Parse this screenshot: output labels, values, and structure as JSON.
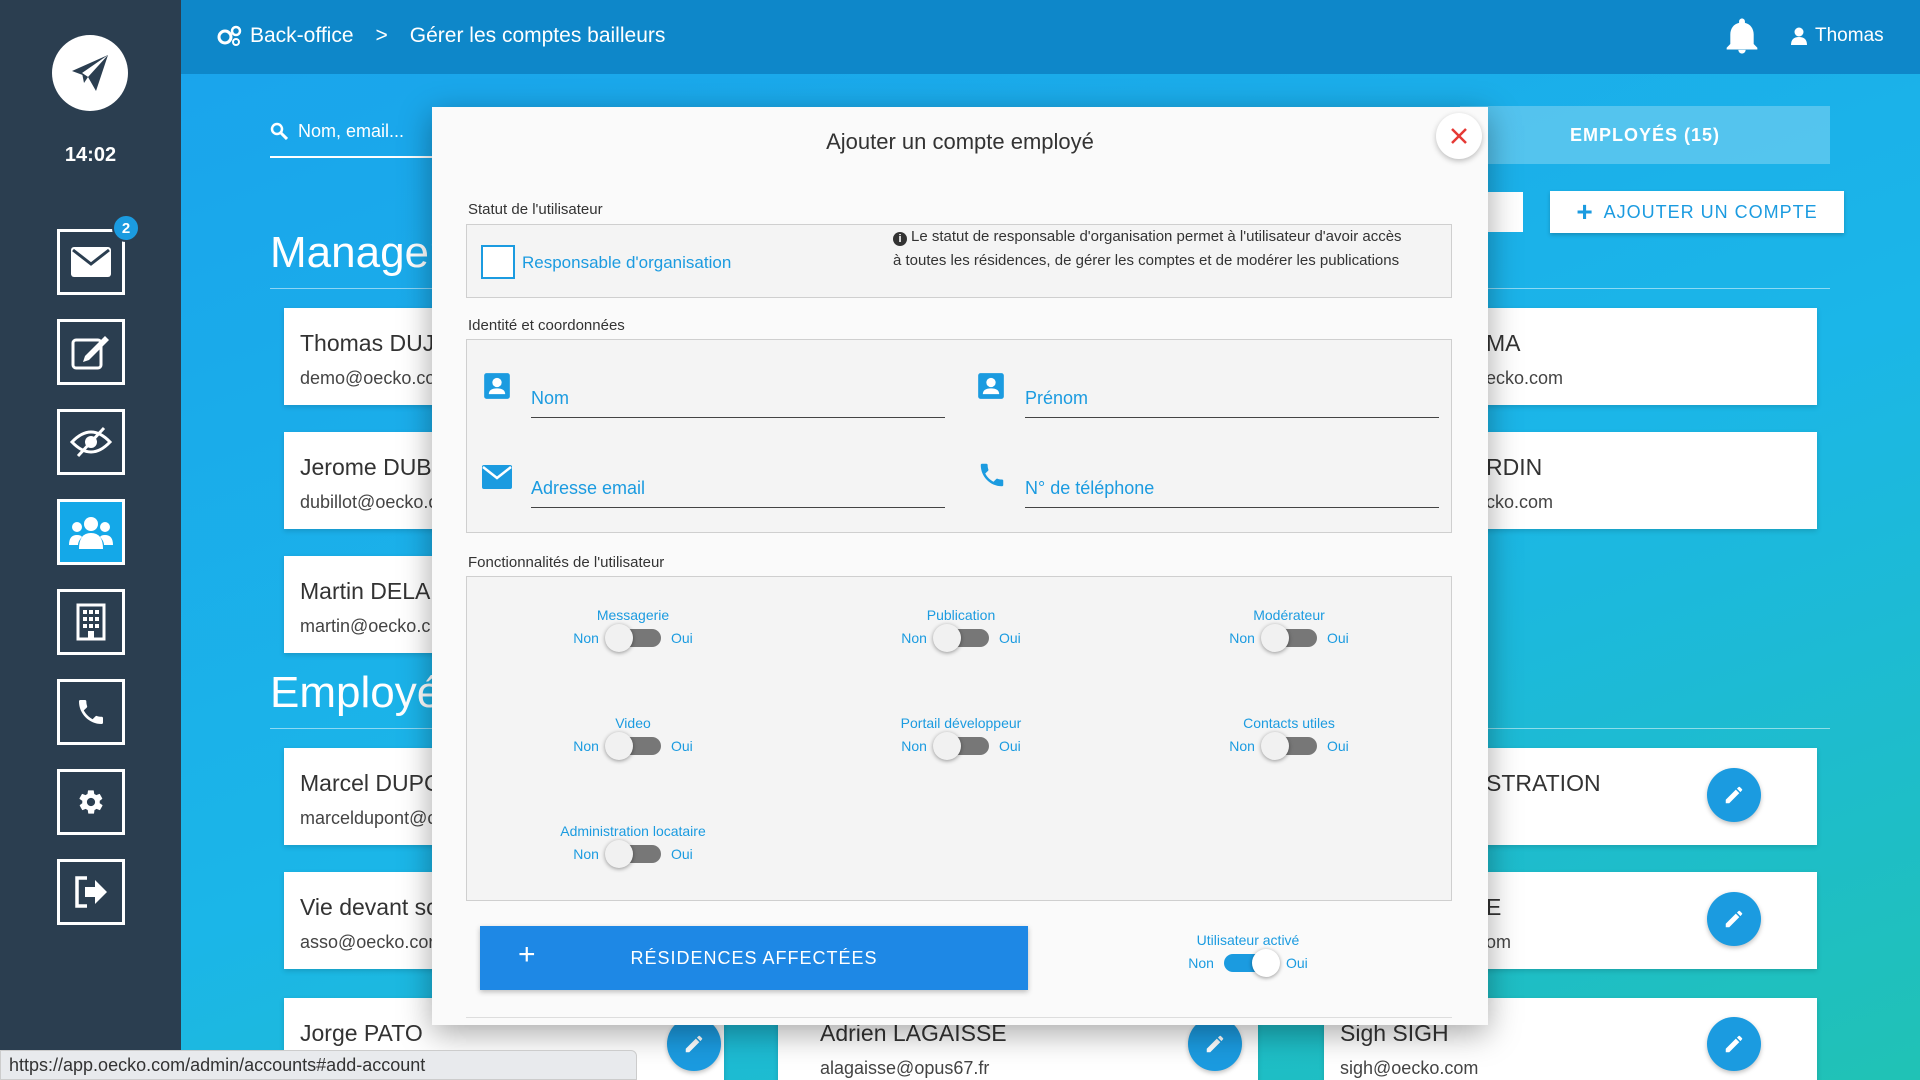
{
  "sidebar": {
    "time": "14:02",
    "mail_badge": "2"
  },
  "topbar": {
    "crumb_root": "Back-office",
    "crumb_sep": ">",
    "crumb_current": "Gérer les comptes bailleurs",
    "user_name": "Thomas"
  },
  "background": {
    "search_placeholder": "Nom, email...",
    "tab_employees": "EMPLOYÉS (15)",
    "add_account": "AJOUTER UN COMPTE",
    "section_managers": "Managers",
    "section_employees": "Employés",
    "managers": [
      {
        "name": "Thomas DUJ",
        "email": "demo@oecko.co"
      },
      {
        "name": "Jerome DUB",
        "email": "dubillot@oecko.c"
      },
      {
        "name": "Martin DELA",
        "email": "martin@oecko.c"
      }
    ],
    "managers_right": [
      {
        "name": "MA",
        "email": "ecko.com"
      },
      {
        "name": "RDIN",
        "email": "cko.com"
      }
    ],
    "employees": [
      {
        "name": "Marcel DUPC",
        "email": "marceldupont@c"
      },
      {
        "name": "Vie devant sc",
        "email": "asso@oecko.cor"
      },
      {
        "name": "Jorge PATO",
        "email": ""
      }
    ],
    "employees_right": [
      {
        "name": "STRATION",
        "email": ""
      },
      {
        "name": "E",
        "email": "om"
      },
      {
        "name": "Sigh SIGH",
        "email": "sigh@oecko.com"
      }
    ],
    "employee_mid": {
      "name": "Adrien LAGAISSE",
      "email": "alagaisse@opus67.fr"
    },
    "status_url": "https://app.oecko.com/admin/accounts#add-account"
  },
  "modal": {
    "title": "Ajouter un compte employé",
    "status_section": "Statut de l'utilisateur",
    "org_manager_label": "Responsable d'organisation",
    "org_manager_checked": false,
    "org_manager_info": "Le statut de responsable d'organisation permet à l'utilisateur d'avoir accès à toutes les résidences, de gérer les comptes et de modérer les publications",
    "identity_section": "Identité et coordonnées",
    "fields": {
      "last_name": "Nom",
      "first_name": "Prénom",
      "email": "Adresse email",
      "phone": "N° de téléphone"
    },
    "features_section": "Fonctionnalités de l'utilisateur",
    "toggle_off": "Non",
    "toggle_on": "Oui",
    "features": [
      {
        "label": "Messagerie",
        "enabled": false
      },
      {
        "label": "Publication",
        "enabled": false
      },
      {
        "label": "Modérateur",
        "enabled": false
      },
      {
        "label": "Video",
        "enabled": false
      },
      {
        "label": "Portail développeur",
        "enabled": false
      },
      {
        "label": "Contacts utiles",
        "enabled": false
      },
      {
        "label": "Administration locataire",
        "enabled": false
      }
    ],
    "residences_button": "RÉSIDENCES AFFECTÉES",
    "active_user_label": "Utilisateur activé",
    "active_user_enabled": true
  },
  "colors": {
    "accent": "#1b9be0",
    "sidebar": "#2b3e50",
    "topbar": "#0e87c9",
    "close": "#e53935"
  }
}
